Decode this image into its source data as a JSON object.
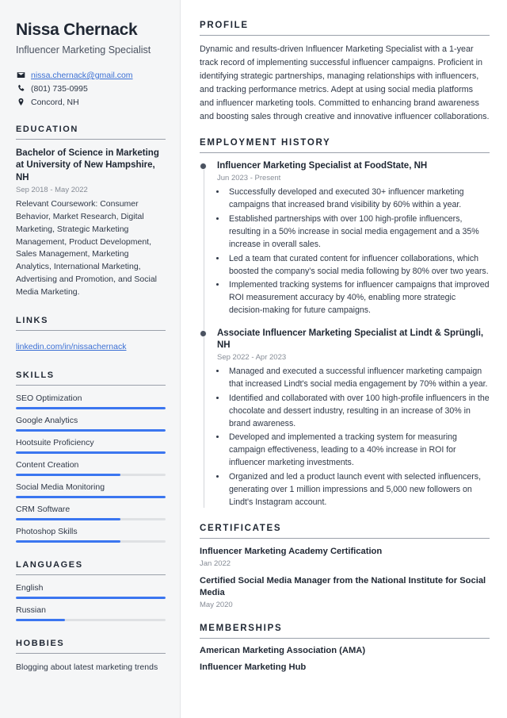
{
  "header": {
    "name": "Nissa Chernack",
    "job_title": "Influencer Marketing Specialist",
    "contacts": [
      {
        "icon": "envelope-icon",
        "value": "nissa.chernack@gmail.com",
        "is_link": true
      },
      {
        "icon": "phone-icon",
        "value": "(801) 735-0995",
        "is_link": false
      },
      {
        "icon": "location-pin-icon",
        "value": "Concord, NH",
        "is_link": false
      }
    ]
  },
  "sidebar": {
    "education": {
      "heading": "EDUCATION",
      "degree": "Bachelor of Science in Marketing at University of New Hampshire, NH",
      "date": "Sep 2018 - May 2022",
      "description": "Relevant Coursework: Consumer Behavior, Market Research, Digital Marketing, Strategic Marketing Management, Product Development, Sales Management, Marketing Analytics, International Marketing, Advertising and Promotion, and Social Media Marketing."
    },
    "links": {
      "heading": "LINKS",
      "items": [
        {
          "label": "linkedin.com/in/nissachernack"
        }
      ]
    },
    "skills": {
      "heading": "SKILLS",
      "items": [
        {
          "label": "SEO Optimization",
          "level": 100
        },
        {
          "label": "Google Analytics",
          "level": 100
        },
        {
          "label": "Hootsuite Proficiency",
          "level": 100
        },
        {
          "label": "Content Creation",
          "level": 70
        },
        {
          "label": "Social Media Monitoring",
          "level": 100
        },
        {
          "label": "CRM Software",
          "level": 70
        },
        {
          "label": "Photoshop Skills",
          "level": 70
        }
      ]
    },
    "languages": {
      "heading": "LANGUAGES",
      "items": [
        {
          "label": "English",
          "level": 100
        },
        {
          "label": "Russian",
          "level": 33
        }
      ]
    },
    "hobbies": {
      "heading": "HOBBIES",
      "items": [
        {
          "label": "Blogging about latest marketing trends"
        }
      ]
    }
  },
  "main": {
    "profile": {
      "heading": "PROFILE",
      "text": "Dynamic and results-driven Influencer Marketing Specialist with a 1-year track record of implementing successful influencer campaigns. Proficient in identifying strategic partnerships, managing relationships with influencers, and tracking performance metrics. Adept at using social media platforms and influencer marketing tools. Committed to enhancing brand awareness and boosting sales through creative and innovative influencer collaborations."
    },
    "employment": {
      "heading": "EMPLOYMENT HISTORY",
      "jobs": [
        {
          "role": "Influencer Marketing Specialist at FoodState, NH",
          "date": "Jun 2023 - Present",
          "bullets": [
            "Successfully developed and executed 30+ influencer marketing campaigns that increased brand visibility by 60% within a year.",
            "Established partnerships with over 100 high-profile influencers, resulting in a 50% increase in social media engagement and a 35% increase in overall sales.",
            "Led a team that curated content for influencer collaborations, which boosted the company's social media following by 80% over two years.",
            "Implemented tracking systems for influencer campaigns that improved ROI measurement accuracy by 40%, enabling more strategic decision-making for future campaigns."
          ]
        },
        {
          "role": "Associate Influencer Marketing Specialist at Lindt & Sprüngli, NH",
          "date": "Sep 2022 - Apr 2023",
          "bullets": [
            "Managed and executed a successful influencer marketing campaign that increased Lindt's social media engagement by 70% within a year.",
            "Identified and collaborated with over 100 high-profile influencers in the chocolate and dessert industry, resulting in an increase of 30% in brand awareness.",
            "Developed and implemented a tracking system for measuring campaign effectiveness, leading to a 40% increase in ROI for influencer marketing investments.",
            "Organized and led a product launch event with selected influencers, generating over 1 million impressions and 5,000 new followers on Lindt's Instagram account."
          ]
        }
      ]
    },
    "certificates": {
      "heading": "CERTIFICATES",
      "items": [
        {
          "title": "Influencer Marketing Academy Certification",
          "date": "Jan 2022"
        },
        {
          "title": "Certified Social Media Manager from the National Institute for Social Media",
          "date": "May 2020"
        }
      ]
    },
    "memberships": {
      "heading": "MEMBERSHIPS",
      "items": [
        {
          "label": "American Marketing Association (AMA)"
        },
        {
          "label": "Influencer Marketing Hub"
        }
      ]
    }
  },
  "colors": {
    "accent": "#3b76f0",
    "link": "#3b6fd4",
    "heading": "#1f2733",
    "muted": "#868c96",
    "sidebar_bg": "#f5f6f7"
  }
}
